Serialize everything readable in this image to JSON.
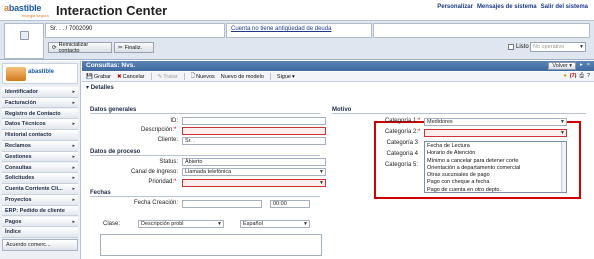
{
  "header": {
    "logo_text_a": "a",
    "logo_text_rest": "bastible",
    "logo_sub": "energia segura",
    "title": "Interaction Center",
    "links": [
      "Personalizar",
      "Mensajes de sistema",
      "Salir del sistema"
    ]
  },
  "context": {
    "contact_field": "Sr. . . / 7002090",
    "message_link": "Cuenta no tiene antigüedad de deuda",
    "btn_reset": "Reinicializar contacto",
    "btn_fin": "Finaliz.",
    "listo_label": "Listo",
    "operativo_placeholder": "No operativo"
  },
  "nav": {
    "logo_label": "abastible",
    "items": [
      {
        "label": "Identificador",
        "has_caret": true
      },
      {
        "label": "Facturación",
        "has_caret": true
      },
      {
        "label": "Registro de Contacto",
        "has_caret": false
      },
      {
        "label": "Datos Técnicos",
        "has_caret": true
      },
      {
        "label": "Historial contacto",
        "has_caret": false
      },
      {
        "label": "Reclamos",
        "has_caret": true
      },
      {
        "label": "Gestiones",
        "has_caret": true
      },
      {
        "label": "Consultas",
        "has_caret": true
      },
      {
        "label": "Solicitudes",
        "has_caret": true
      },
      {
        "label": "Cuenta Corriente Cli...",
        "has_caret": true
      },
      {
        "label": "Proyectos",
        "has_caret": true
      },
      {
        "label": "ERP: Pedido de cliente",
        "has_caret": false
      },
      {
        "label": "Pagos",
        "has_caret": true
      },
      {
        "label": "Índice",
        "has_caret": false
      }
    ],
    "bottom": "Acuerdo comerc..."
  },
  "main": {
    "title": "Consultas: Nvs.",
    "volver": "Volver",
    "toolbar": {
      "grabar": "Grabar",
      "cancelar": "Cancelar",
      "tratar": "Tratar",
      "nuevos": "Nuevos",
      "nuevo_modelo": "Nuevo de modelo",
      "sigue": "Sigue",
      "count": "(7)"
    },
    "detalles": "Detalles",
    "datos_generales": "Datos generales",
    "id_label": "ID:",
    "descripcion_label": "Descripción:",
    "cliente_label": "Cliente:",
    "cliente_value": "Sr. .",
    "datos_proceso": "Datos de proceso",
    "status_label": "Status:",
    "status_value": "Abierto",
    "canal_label": "Canal de ingreso:",
    "canal_value": "Llamada telefónica",
    "prioridad_label": "Prioridad:",
    "fechas": "Fechas",
    "fecha_creacion_label": "Fecha Creación:",
    "fecha_creacion_value": "00:00",
    "clase_label": "Clase:",
    "clase_value": "Descripción probl",
    "idioma_value": "Español",
    "motivo": "Motivo",
    "categoria1_label": "Categoría 1:",
    "categoria1_value": "Medidores",
    "categoria2_label": "Categoría 2:",
    "categoria3_label": "Categoría 3",
    "categoria4_label": "Categoría 4",
    "categoria5_label": "Categoría 5:",
    "dropdown_options": [
      "Fecha de Lectura",
      "Horario de Atención",
      "Mínimo a cancelar para detener corte",
      "Orientación a departamento comercial",
      "Otras sucursales de pago",
      "Pago con cheque a fecha",
      "Pago de cuenta en otro depto."
    ]
  }
}
